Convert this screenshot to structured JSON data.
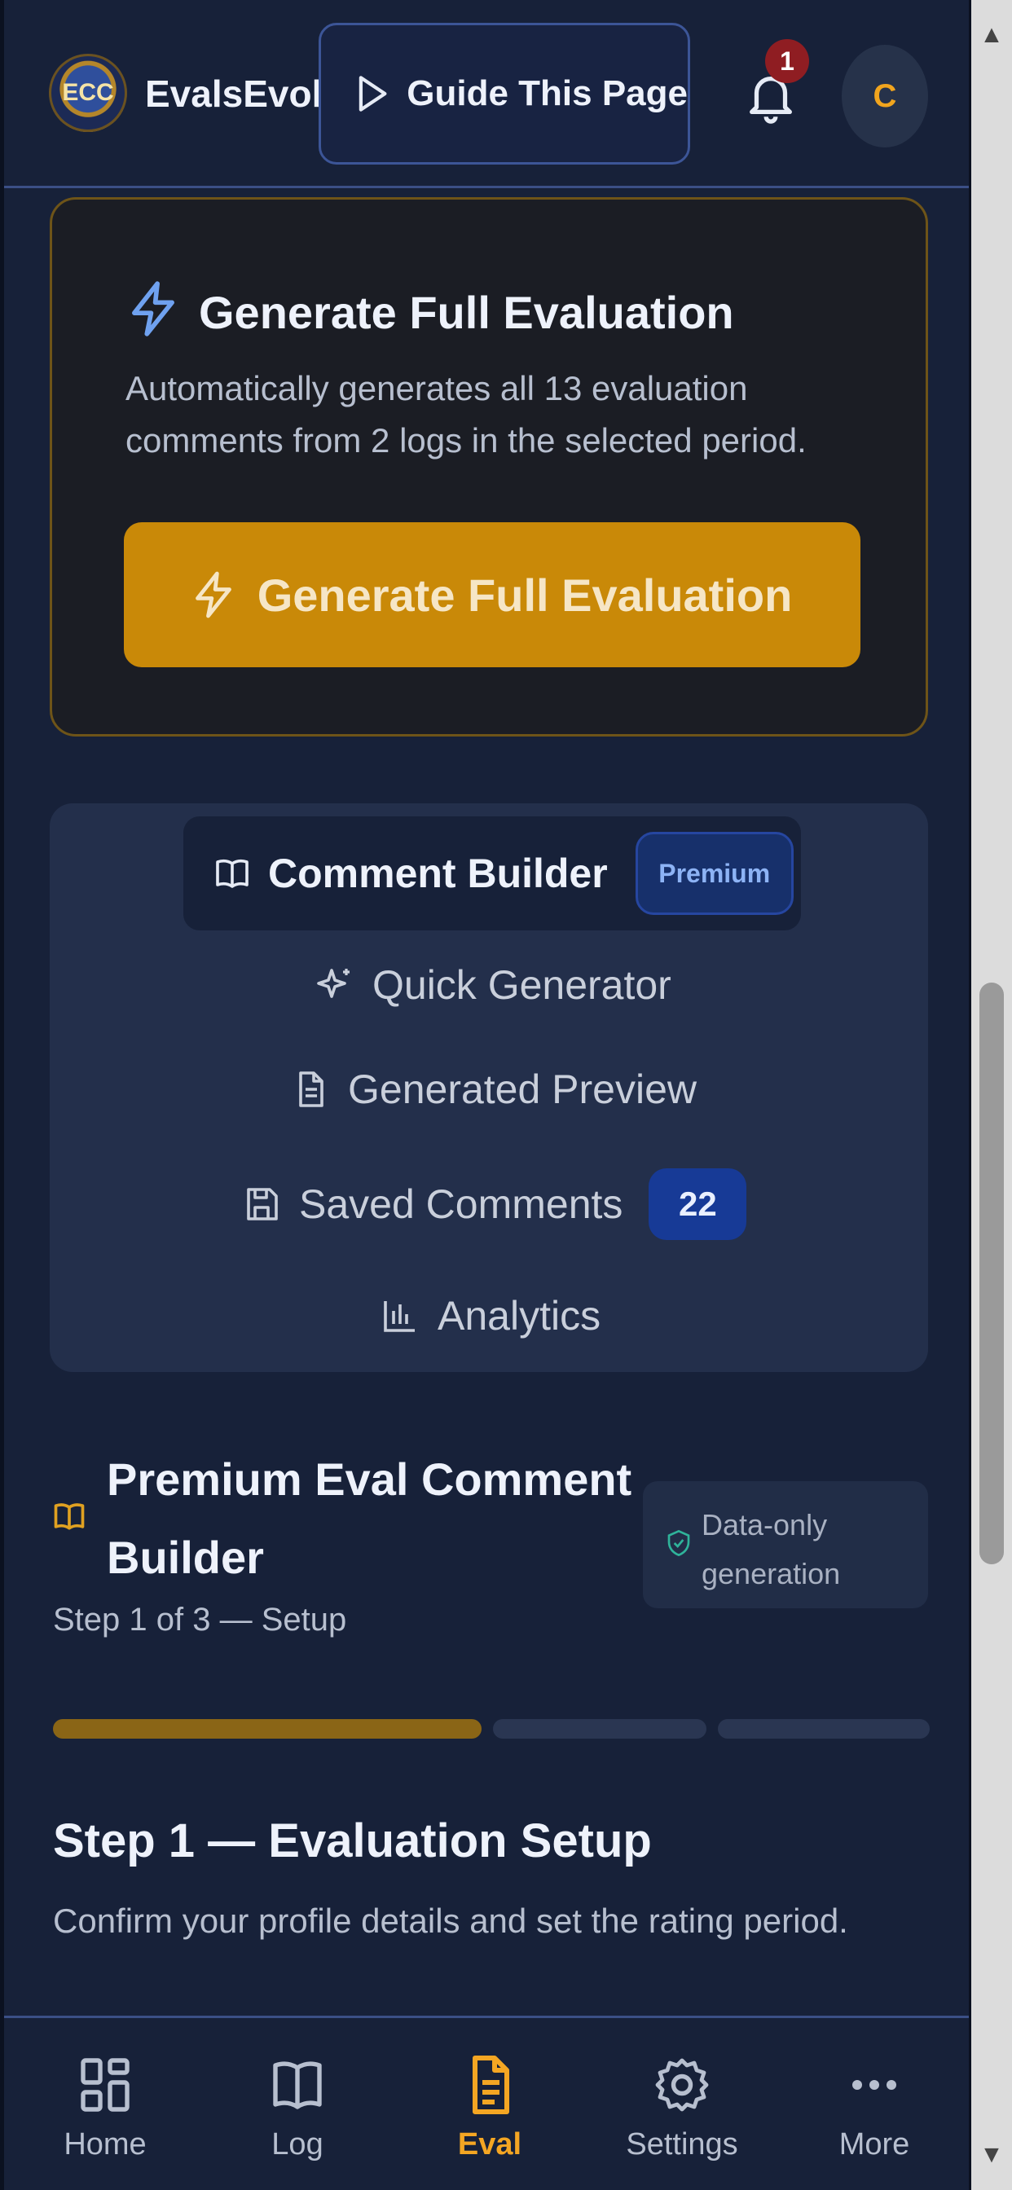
{
  "header": {
    "app_name": "EvalsEvol",
    "logo_text": "ECC",
    "guide_button": "Guide This Page",
    "notification_count": "1",
    "avatar_initial": "C"
  },
  "generate_card": {
    "title": "Generate Full Evaluation",
    "description": "Automatically generates all 13 evaluation comments from 2 logs in the selected period.",
    "button_label": "Generate Full Evaluation"
  },
  "tabs": {
    "comment_builder": "Comment Builder",
    "premium_badge": "Premium",
    "quick_generator": "Quick Generator",
    "generated_preview": "Generated Preview",
    "saved_comments": "Saved Comments",
    "saved_count": "22",
    "analytics": "Analytics"
  },
  "builder": {
    "title": "Premium Eval Comment Builder",
    "step_text": "Step 1 of 3 — Setup",
    "data_badge": "Data-only generation",
    "progress": {
      "current_step": 1,
      "total_steps": 3
    }
  },
  "step": {
    "heading": "Step 1 — Evaluation Setup",
    "description": "Confirm your profile details and set the rating period."
  },
  "bottom_nav": {
    "items": [
      {
        "label": "Home",
        "icon": "grid-icon"
      },
      {
        "label": "Log",
        "icon": "book-icon"
      },
      {
        "label": "Eval",
        "icon": "document-icon",
        "active": true
      },
      {
        "label": "Settings",
        "icon": "gear-icon"
      },
      {
        "label": "More",
        "icon": "more-icon"
      }
    ]
  },
  "colors": {
    "accent": "#c98908",
    "active_nav": "#f4a623",
    "background": "#172139",
    "badge_blue": "#173a96",
    "notification_red": "#8f1d22"
  }
}
